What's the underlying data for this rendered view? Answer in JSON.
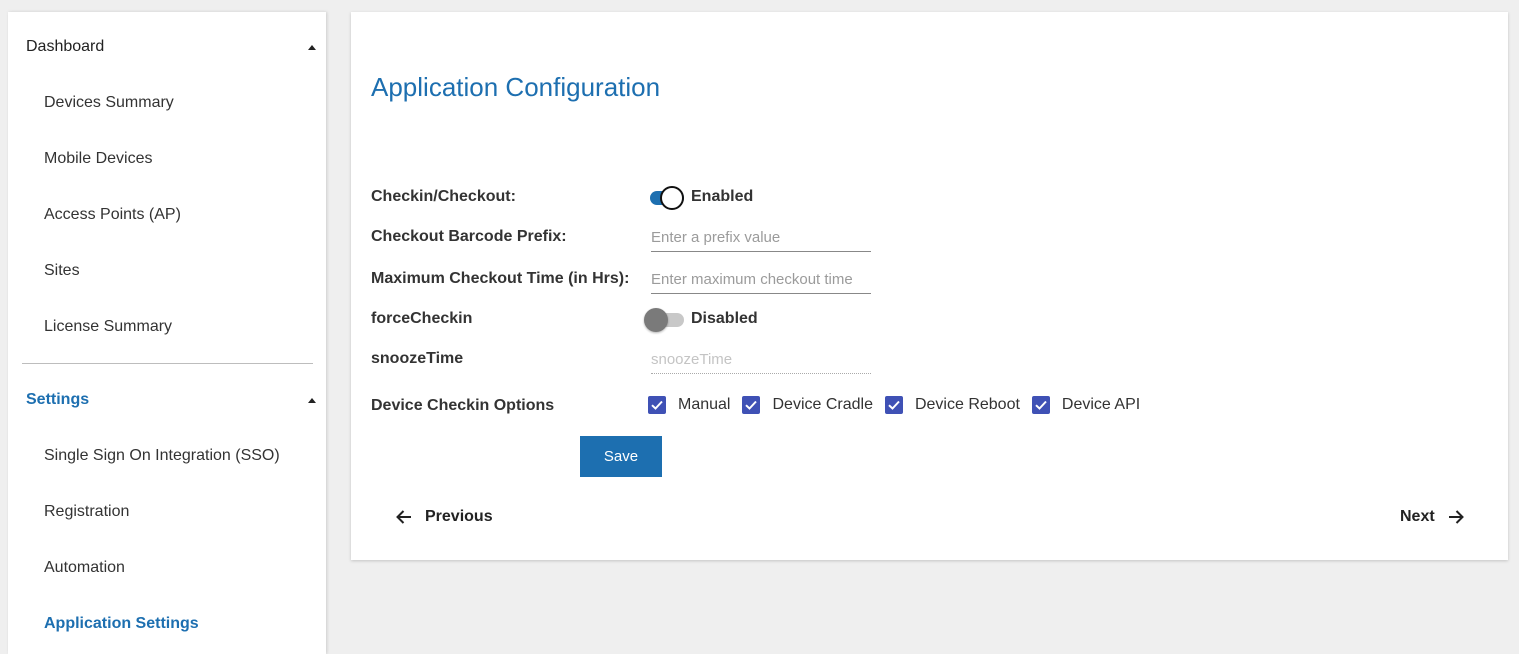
{
  "sidebar": {
    "sections": [
      {
        "title": "Dashboard",
        "items": [
          "Devices Summary",
          "Mobile Devices",
          "Access Points (AP)",
          "Sites",
          "License Summary"
        ]
      },
      {
        "title": "Settings",
        "items": [
          "Single Sign On Integration (SSO)",
          "Registration",
          "Automation",
          "Application Settings"
        ]
      }
    ],
    "active_item": "Application Settings"
  },
  "main": {
    "title": "Application Configuration",
    "form": {
      "checkin_checkout": {
        "label": "Checkin/Checkout:",
        "enabled": true,
        "status": "Enabled"
      },
      "barcode_prefix": {
        "label": "Checkout Barcode Prefix:",
        "value": "",
        "placeholder": "Enter a prefix value"
      },
      "max_checkout_time": {
        "label": "Maximum Checkout Time (in Hrs):",
        "value": "",
        "placeholder": "Enter maximum checkout time"
      },
      "force_checkin": {
        "label": "forceCheckin",
        "enabled": false,
        "status": "Disabled"
      },
      "snooze_time": {
        "label": "snoozeTime",
        "value": "",
        "placeholder": "snoozeTime",
        "disabled": true
      },
      "device_checkin_options": {
        "label": "Device Checkin Options",
        "options": [
          {
            "label": "Manual",
            "checked": true
          },
          {
            "label": "Device Cradle",
            "checked": true
          },
          {
            "label": "Device Reboot",
            "checked": true
          },
          {
            "label": "Device API",
            "checked": true
          }
        ]
      }
    },
    "save_label": "Save",
    "previous_label": "Previous",
    "next_label": "Next"
  },
  "colors": {
    "accent": "#1d6fb0",
    "checkbox": "#3f51b5",
    "background": "#efefef"
  },
  "icons": {
    "dashboard_caret": "caret-up-icon",
    "settings_caret": "caret-up-icon",
    "previous": "arrow-left-icon",
    "next": "arrow-right-icon",
    "checkbox": "check-icon"
  }
}
